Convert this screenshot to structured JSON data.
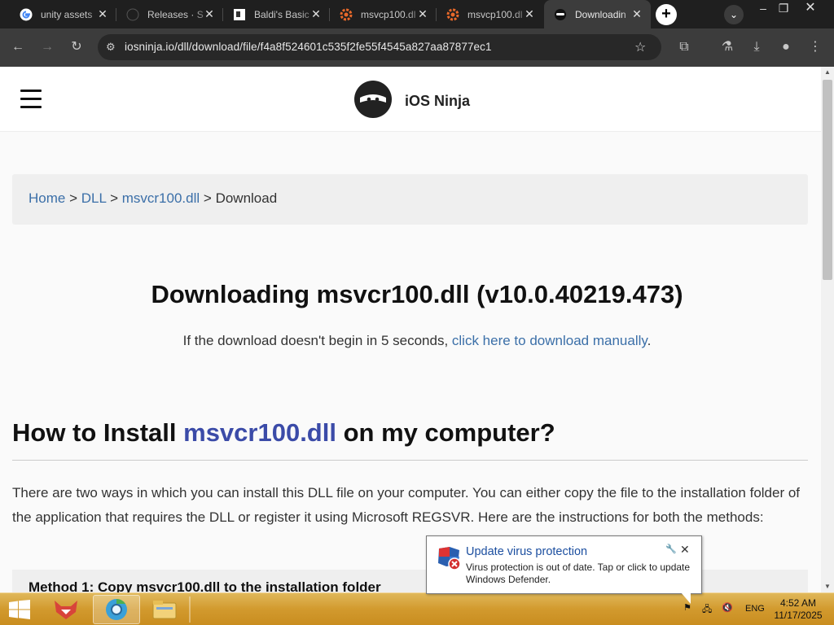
{
  "tabs": [
    {
      "title": "unity assets",
      "icon": "google-icon"
    },
    {
      "title": "Releases · S",
      "icon": "github-icon"
    },
    {
      "title": "Baldi's Basic",
      "icon": "page-icon"
    },
    {
      "title": "msvcp100.dl",
      "icon": "gear-icon"
    },
    {
      "title": "msvcp100.dl",
      "icon": "gear-icon"
    },
    {
      "title": "Downloadin",
      "icon": "ninja-icon"
    }
  ],
  "address_bar": {
    "url": "iosninja.io/dll/download/file/f4a8f524601c535f2fe55f4545a827aa87877ec1"
  },
  "site": {
    "brand": "iOS Ninja"
  },
  "breadcrumb": {
    "home": "Home",
    "sep1": ">",
    "dll": "DLL",
    "sep2": ">",
    "file": "msvcr100.dll",
    "sep3": ">",
    "current": "Download"
  },
  "download": {
    "title": "Downloading msvcr100.dll (v10.0.40219.473)",
    "note_prefix": "If the download doesn't begin in 5 seconds, ",
    "note_link": "click here to download manually",
    "note_suffix": "."
  },
  "install": {
    "heading_prefix": "How to Install ",
    "heading_dll": "msvcr100.dll",
    "heading_suffix": " on my computer?",
    "paragraph": "There are two ways in which you can install this DLL file on your computer. You can either copy the file to the installation folder of the application that requires the DLL or register it using Microsoft REGSVR. Here are the instructions for both the methods:",
    "next_box": "Method 1: Copy msvcr100.dll to the installation folder"
  },
  "notification": {
    "title": "Update virus protection",
    "message": "Virus protection is out of date. Tap or click to update Windows Defender."
  },
  "taskbar": {
    "language": "ENG",
    "time": "4:52 AM",
    "date": "11/17/2025"
  },
  "colors": {
    "link": "#3b6fa8",
    "heading_dll": "#3b4ba8",
    "taskbar": "#d29a2e",
    "browser_dark": "#1f1f1f"
  }
}
